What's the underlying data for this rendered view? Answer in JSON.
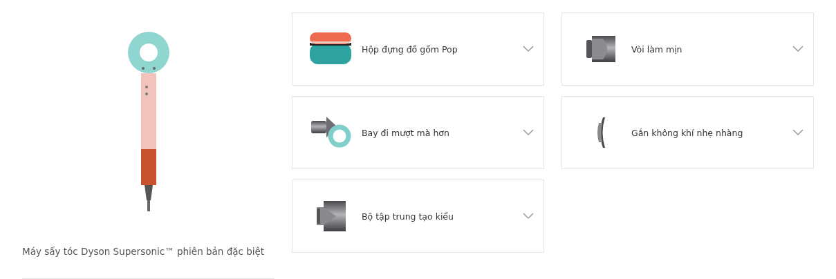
{
  "product": {
    "caption": "Máy sấy tóc Dyson Supersonic™ phiên bản đặc biệt"
  },
  "accessories": [
    {
      "label": "Hộp đựng đồ gốm Pop",
      "kind": "case",
      "expanded": false
    },
    {
      "label": "Vòi làm mịn",
      "kind": "smoothing",
      "expanded": false
    },
    {
      "label": "Bay đi mượt mà hơn",
      "kind": "flyaway",
      "expanded": false
    },
    {
      "label": "Gắn không khí nhẹ nhàng",
      "kind": "gentle",
      "expanded": false
    },
    {
      "label": "Bộ tập trung tạo kiểu",
      "kind": "concentrator",
      "expanded": false
    }
  ]
}
